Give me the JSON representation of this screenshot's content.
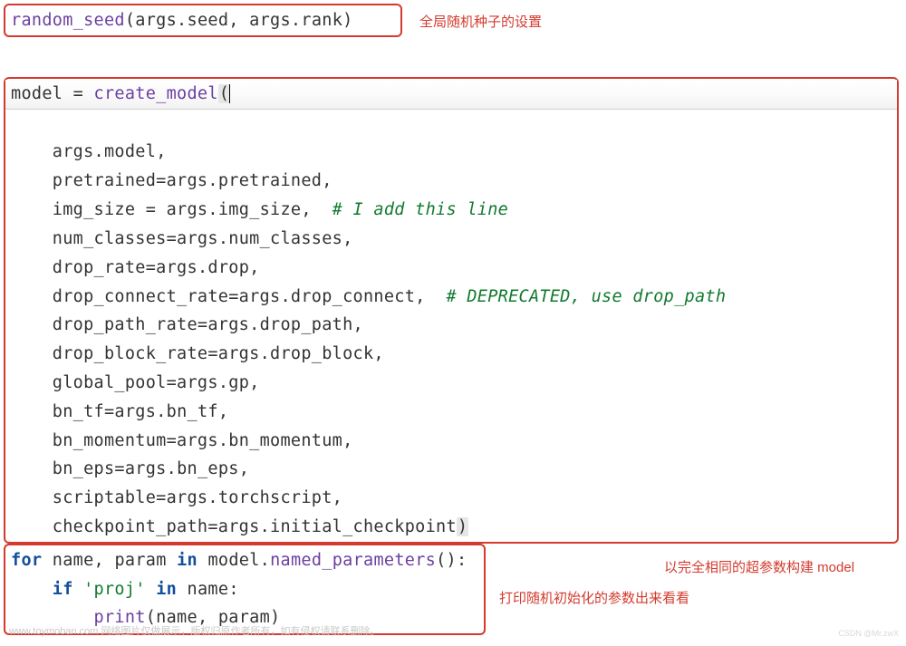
{
  "annotations": {
    "anno1": "全局随机种子的设置",
    "anno2": "以完全相同的超参数构建 model",
    "anno3": "打印随机初始化的参数出来看看"
  },
  "watermark": {
    "left": "www.toymoban.com 网络图片仅做展示，版权归原作者所有，如有侵权请联系删除。",
    "right": "CSDN @Mr.zwX"
  },
  "region1": {
    "fn": "random_seed",
    "arg1_obj": "args",
    "arg1_attr": "seed",
    "arg2_obj": "args",
    "arg2_attr": "rank"
  },
  "region2": {
    "assign_lhs": "model",
    "fn": "create_model",
    "lines": [
      {
        "head": "args",
        "dot": ".",
        "attr": "model",
        "tail": ","
      },
      {
        "kw": "pretrained",
        "eq": "=",
        "obj": "args",
        "dot": ".",
        "attr": "pretrained",
        "tail": ","
      },
      {
        "kw": "img_size",
        "eqsp": " = ",
        "obj": "args",
        "dot": ".",
        "attr": "img_size",
        "tail": ",  ",
        "comment": "# I add this line"
      },
      {
        "kw": "num_classes",
        "eq": "=",
        "obj": "args",
        "dot": ".",
        "attr": "num_classes",
        "tail": ","
      },
      {
        "kw": "drop_rate",
        "eq": "=",
        "obj": "args",
        "dot": ".",
        "attr": "drop",
        "tail": ","
      },
      {
        "kw": "drop_connect_rate",
        "eq": "=",
        "obj": "args",
        "dot": ".",
        "attr": "drop_connect",
        "tail": ",  ",
        "comment": "# DEPRECATED, use drop_path"
      },
      {
        "kw": "drop_path_rate",
        "eq": "=",
        "obj": "args",
        "dot": ".",
        "attr": "drop_path",
        "tail": ","
      },
      {
        "kw": "drop_block_rate",
        "eq": "=",
        "obj": "args",
        "dot": ".",
        "attr": "drop_block",
        "tail": ","
      },
      {
        "kw": "global_pool",
        "eq": "=",
        "obj": "args",
        "dot": ".",
        "attr": "gp",
        "tail": ","
      },
      {
        "kw": "bn_tf",
        "eq": "=",
        "obj": "args",
        "dot": ".",
        "attr": "bn_tf",
        "tail": ","
      },
      {
        "kw": "bn_momentum",
        "eq": "=",
        "obj": "args",
        "dot": ".",
        "attr": "bn_momentum",
        "tail": ","
      },
      {
        "kw": "bn_eps",
        "eq": "=",
        "obj": "args",
        "dot": ".",
        "attr": "bn_eps",
        "tail": ","
      },
      {
        "kw": "scriptable",
        "eq": "=",
        "obj": "args",
        "dot": ".",
        "attr": "torchscript",
        "tail": ","
      },
      {
        "kw": "checkpoint_path",
        "eq": "=",
        "obj": "args",
        "dot": ".",
        "attr": "initial_checkpoint",
        "close": ")"
      }
    ]
  },
  "region3": {
    "l1": {
      "kw_for": "for",
      "v1": "name",
      "comma": ", ",
      "v2": "param",
      "kw_in": "in",
      "obj": "model",
      "dot": ".",
      "method": "named_parameters",
      "parens": "()",
      "colon": ":"
    },
    "l2": {
      "kw_if": "if",
      "str": "'proj'",
      "kw_in": "in",
      "var": "name",
      "colon": ":"
    },
    "l3": {
      "fn": "print",
      "open": "(",
      "a1": "name",
      "comma": ", ",
      "a2": "param",
      "close": ")"
    }
  }
}
